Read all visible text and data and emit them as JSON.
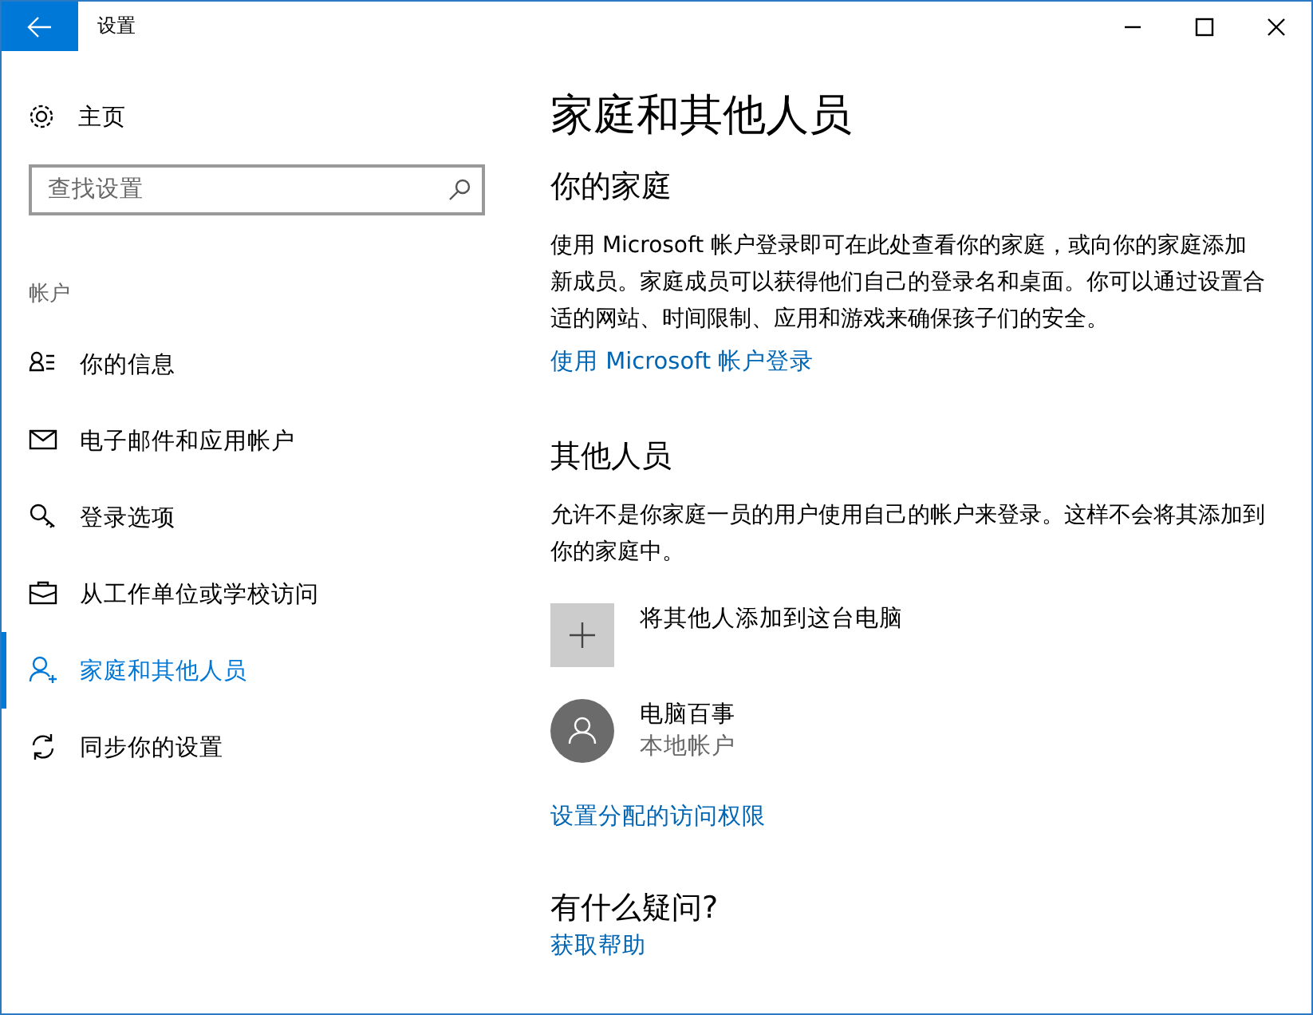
{
  "window": {
    "title": "设置"
  },
  "sidebar": {
    "home": "主页",
    "search": {
      "placeholder": "查找设置"
    },
    "section": "帐户",
    "items": [
      {
        "kind": "info",
        "label": "你的信息",
        "selected": false
      },
      {
        "kind": "mail",
        "label": "电子邮件和应用帐户",
        "selected": false
      },
      {
        "kind": "key",
        "label": "登录选项",
        "selected": false
      },
      {
        "kind": "work",
        "label": "从工作单位或学校访问",
        "selected": false
      },
      {
        "kind": "family",
        "label": "家庭和其他人员",
        "selected": true
      },
      {
        "kind": "sync",
        "label": "同步你的设置",
        "selected": false
      }
    ]
  },
  "content": {
    "title": "家庭和其他人员",
    "family": {
      "heading": "你的家庭",
      "text": "使用 Microsoft 帐户登录即可在此处查看你的家庭，或向你的家庭添加新成员。家庭成员可以获得他们自己的登录名和桌面。你可以通过设置合适的网站、时间限制、应用和游戏来确保孩子们的安全。",
      "link": "使用 Microsoft 帐户登录"
    },
    "others": {
      "heading": "其他人员",
      "text": "允许不是你家庭一员的用户使用自己的帐户来登录。这样不会将其添加到你的家庭中。",
      "entries": [
        {
          "kind": "add",
          "name": "将其他人添加到这台电脑"
        },
        {
          "kind": "user",
          "name": "电脑百事",
          "detail": "本地帐户"
        }
      ],
      "link": "设置分配的访问权限"
    },
    "help": {
      "heading": "有什么疑问?",
      "link": "获取帮助"
    }
  }
}
